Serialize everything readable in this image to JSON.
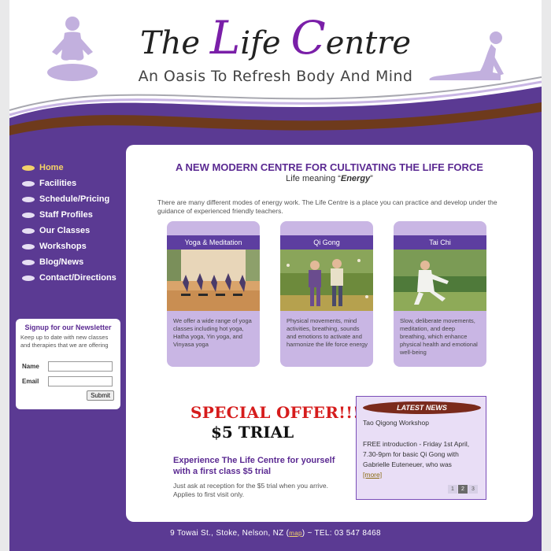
{
  "header": {
    "logo_part1": "The ",
    "logo_L": "L",
    "logo_part2": "ife ",
    "logo_C": "C",
    "logo_part3": "entre",
    "tagline": "An Oasis To Refresh Body And Mind"
  },
  "nav": {
    "items": [
      {
        "label": "Home",
        "active": true
      },
      {
        "label": "Facilities"
      },
      {
        "label": "Schedule/Pricing"
      },
      {
        "label": "Staff Profiles"
      },
      {
        "label": "Our Classes"
      },
      {
        "label": "Workshops"
      },
      {
        "label": "Blog/News"
      },
      {
        "label": "Contact/Directions"
      }
    ]
  },
  "newsletter": {
    "title": "Signup for our Newsletter",
    "text": "Keep up to date with new classes and therapies that we are offering",
    "name_label": "Name",
    "email_label": "Email",
    "submit": "Submit"
  },
  "main": {
    "heading": "A NEW MODERN CENTRE FOR CULTIVATING THE LIFE FORCE",
    "subheading_prefix": "Life meaning “",
    "subheading_word": "Energy",
    "subheading_suffix": "”",
    "intro": "There are many different modes of energy work. The Life Centre is a place you can practice and develop under the guidance of experienced friendly teachers.",
    "cards": [
      {
        "title": "Yoga & Meditation",
        "text": "We offer a wide range of yoga classes including hot yoga, Hatha yoga, Yin yoga, and Vinyasa yoga"
      },
      {
        "title": "Qi Gong",
        "text": "Physical movements, mind activities, breathing, sounds and emotions to activate and harmonize the life force energy"
      },
      {
        "title": "Tai Chi",
        "text": "Slow, deliberate movements, meditation, and deep breathing, which enhance physical health and emotional well-being"
      }
    ]
  },
  "offer": {
    "title": "SPECIAL OFFER!!!",
    "sub": "$5 TRIAL",
    "heading": "Experience The Life Centre for yourself with a first class $5 trial",
    "text": "Just ask at reception for the $5 trial when you arrive. Applies to first visit only."
  },
  "news": {
    "label": "LATEST NEWS",
    "title": "Tao Qigong Workshop",
    "body": "FREE introduction - Friday 1st April, 7.30-9pm for basic Qi Gong with Gabrielle Euteneuer, who was",
    "more": "[more]",
    "pages": [
      "1",
      "2",
      "3"
    ]
  },
  "footer": {
    "address": "9 Towai St., Stoke, Nelson, NZ (",
    "map": "map",
    "phone": ")  ~  TEL: 03 547 8468"
  },
  "colors": {
    "brand_purple": "#5b3a93",
    "accent_yellow": "#f2d16a",
    "offer_red": "#d61c1c"
  }
}
